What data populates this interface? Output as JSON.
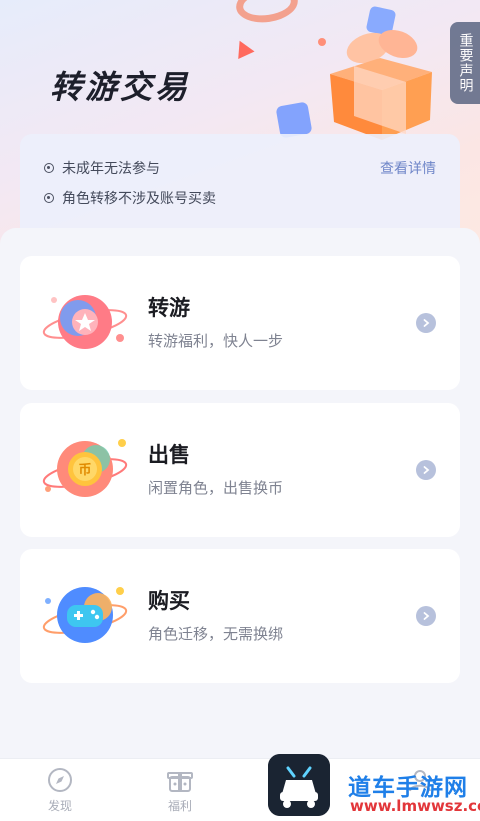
{
  "hero": {
    "title": "转游交易"
  },
  "notice_tab": {
    "label": "重要声明"
  },
  "info_card": {
    "items": [
      "未成年无法参与",
      "角色转移不涉及账号买卖"
    ],
    "detail_link": "查看详情"
  },
  "menu": [
    {
      "title": "转游",
      "subtitle": "转游福利，快人一步",
      "icon": "star-planet-icon"
    },
    {
      "title": "出售",
      "subtitle": "闲置角色，出售换币",
      "icon": "coin-planet-icon"
    },
    {
      "title": "购买",
      "subtitle": "角色迁移，无需换绑",
      "icon": "gamepad-planet-icon"
    }
  ],
  "bottom_nav": [
    {
      "label": "发现",
      "icon": "compass-icon"
    },
    {
      "label": "福利",
      "icon": "gift-box-icon"
    },
    {
      "label": "",
      "icon": "person-icon"
    }
  ],
  "watermark": {
    "text": "道车手游网",
    "url": "www.lmwwsz.com"
  },
  "colors": {
    "accent_link": "#6f86c8",
    "watermark_blue": "#1f7fe8",
    "watermark_red": "#e2363a"
  }
}
